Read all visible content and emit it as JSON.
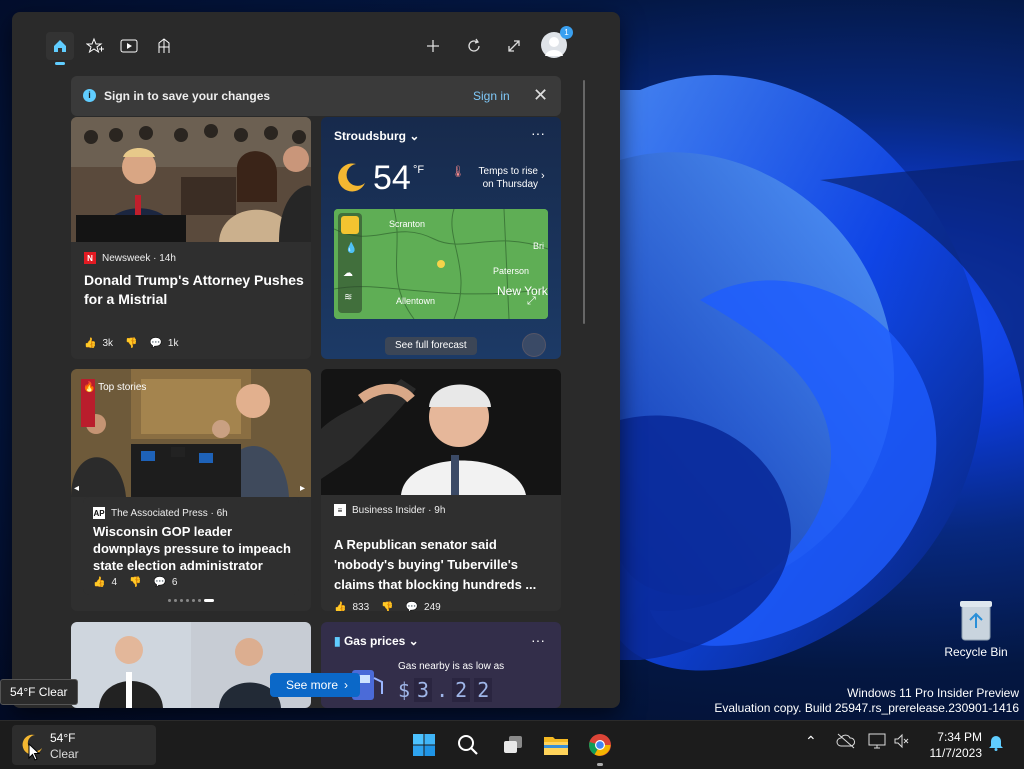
{
  "widgets": {
    "tabs": [
      {
        "name": "home",
        "active": true
      },
      {
        "name": "favorites",
        "active": false
      },
      {
        "name": "video",
        "active": false
      },
      {
        "name": "sports",
        "active": false
      }
    ],
    "badge_count": "1",
    "banner": {
      "text": "Sign in to save your changes",
      "action": "Sign in"
    },
    "cards": {
      "trump": {
        "source": "Newsweek · 14h",
        "title": "Donald Trump's Attorney Pushes for a Mistrial",
        "likes": "3k",
        "comments": "1k"
      },
      "weather": {
        "location": "Stroudsburg",
        "temp": "54",
        "unit": "°F",
        "note": "Temps to rise on Thursday",
        "map_labels": [
          "Scranton",
          "Bri",
          "Paterson",
          "New York",
          "Allentown"
        ],
        "forecast_label": "See full forecast"
      },
      "wisconsin": {
        "tag": "Top stories",
        "source": "The Associated Press · 6h",
        "title": "Wisconsin GOP leader downplays pressure to impeach state election administrator",
        "likes": "4",
        "comments": "6",
        "source_icon_text": "AP"
      },
      "senator": {
        "source": "Business Insider · 9h",
        "title": "A Republican senator said 'nobody's buying' Tuberville's claims that blocking hundreds ...",
        "likes": "833",
        "comments": "249"
      },
      "gas": {
        "title": "Gas prices",
        "subtitle": "Gas nearby is as low as",
        "price": [
          "$",
          "3",
          ".",
          "2",
          "2"
        ]
      }
    },
    "see_more": "See more"
  },
  "desktop": {
    "watermark_line1": "Windows 11 Pro Insider Preview",
    "watermark_line2": "Evaluation copy. Build 25947.rs_prerelease.230901-1416",
    "recycle_bin": "Recycle Bin",
    "tooltip": "54°F Clear"
  },
  "taskbar": {
    "weather_temp": "54°F",
    "weather_cond": "Clear",
    "apps": [
      "windows-start-icon",
      "search-icon",
      "task-view-icon",
      "file-explorer-icon",
      "chrome-icon"
    ],
    "time": "7:34 PM",
    "date": "11/7/2023"
  },
  "colors": {
    "accent": "#60cdff",
    "link": "#7fc8f8",
    "see_more": "#0b68c8",
    "panel": "#2a2a2a",
    "card": "#2f2f2f"
  }
}
